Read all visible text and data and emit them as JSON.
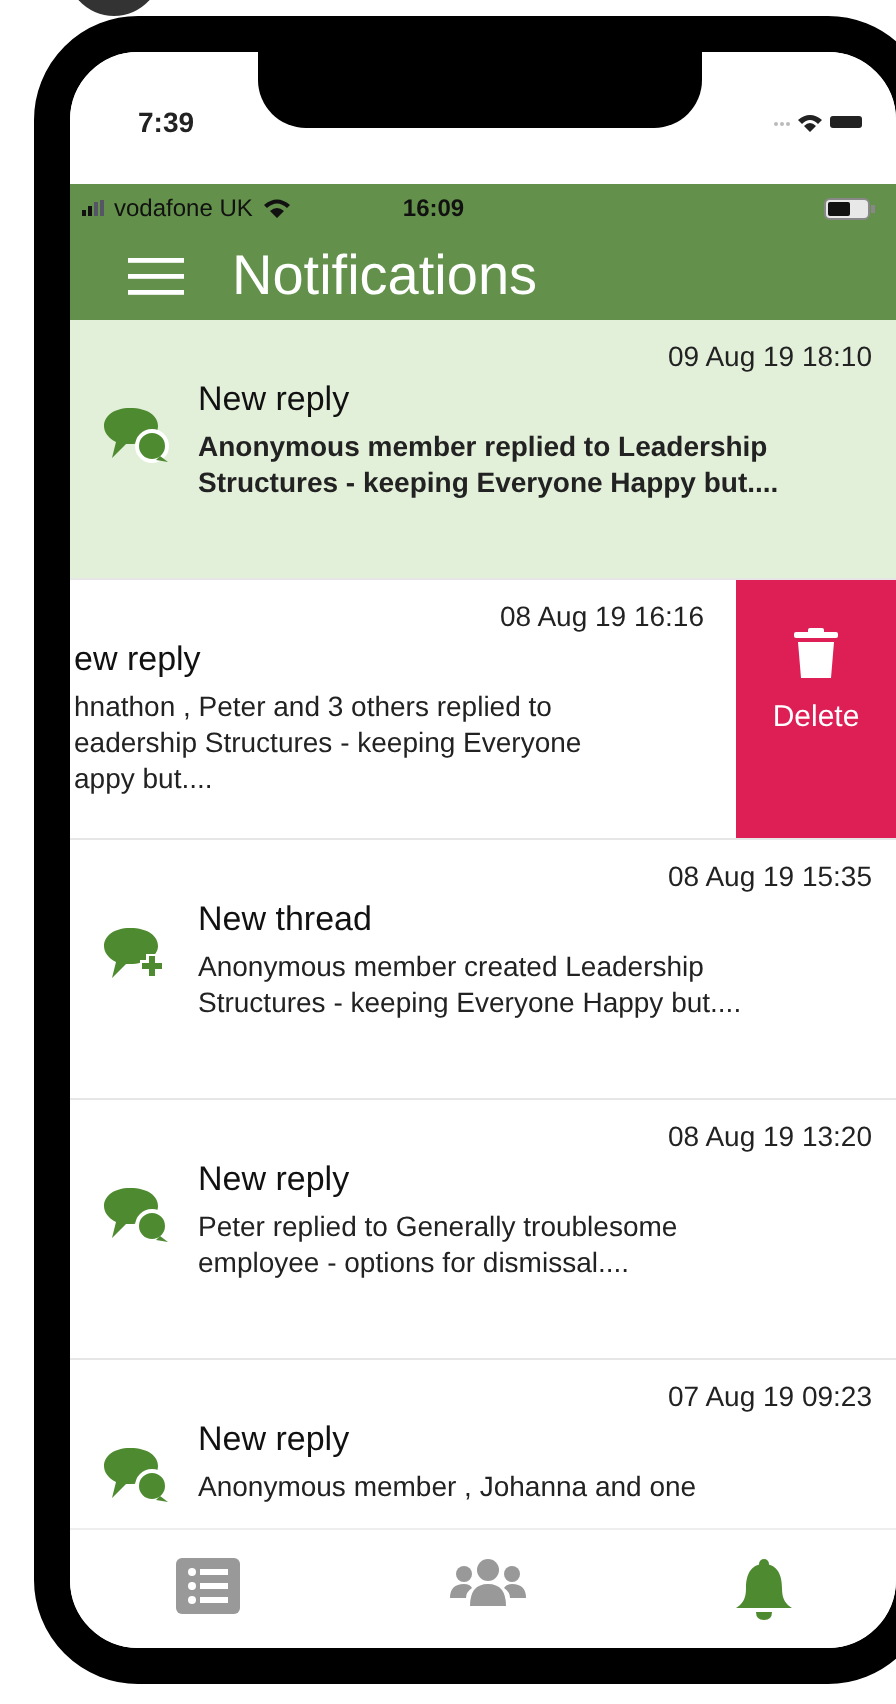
{
  "device_status": {
    "time": "7:39"
  },
  "app_status_bar": {
    "carrier": "vodafone UK",
    "time": "16:09"
  },
  "header": {
    "title": "Notifications"
  },
  "notifications": [
    {
      "kind": "reply",
      "timestamp": "09 Aug 19 18:10",
      "title": "New reply",
      "body": "Anonymous member replied to Leadership Structures - keeping Everyone Happy but....",
      "unread": true,
      "swiped": false
    },
    {
      "timestamp": "08 Aug 19 16:16",
      "title": "ew reply",
      "body": "hnathon , Peter and 3 others replied to\neadership Structures - keeping Everyone\nappy but....",
      "unread": false,
      "swiped": true,
      "action": "Delete"
    },
    {
      "kind": "thread",
      "timestamp": "08 Aug 19 15:35",
      "title": "New thread",
      "body": "Anonymous member created Leadership Structures - keeping Everyone Happy but....",
      "unread": false,
      "swiped": false
    },
    {
      "kind": "reply",
      "timestamp": "08 Aug 19 13:20",
      "title": "New reply",
      "body": "Peter replied to Generally troublesome employee - options for dismissal....",
      "unread": false,
      "swiped": false
    },
    {
      "kind": "reply",
      "timestamp": "07 Aug 19 09:23",
      "title": "New reply",
      "body": "Anonymous member , Johanna and one",
      "unread": false,
      "swiped": false
    }
  ],
  "tabs": [
    {
      "kind": "list",
      "selected": false
    },
    {
      "kind": "people",
      "selected": false
    },
    {
      "kind": "bell",
      "selected": true
    }
  ]
}
